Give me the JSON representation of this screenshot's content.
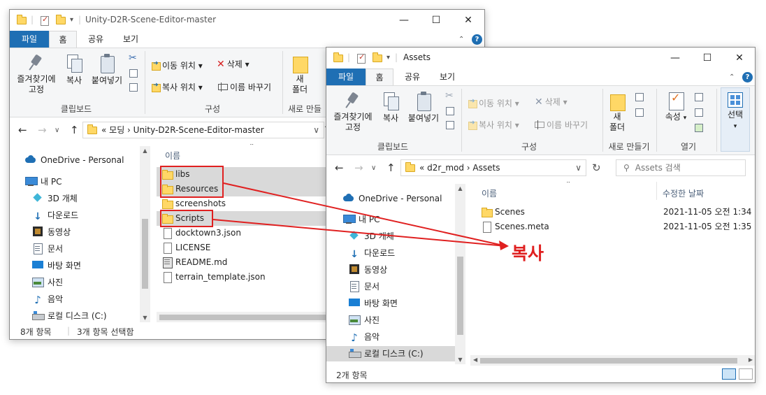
{
  "win1": {
    "title": "Unity-D2R-Scene-Editor-master",
    "tabs": [
      "파일",
      "홈",
      "공유",
      "보기"
    ],
    "ribbon": {
      "pin": "즐겨찾기에\n고정",
      "copy": "복사",
      "paste": "붙여넣기",
      "clipboard_label": "클립보드",
      "move_to": "이동 위치",
      "delete": "삭제",
      "copy_to": "복사 위치",
      "rename": "이름 바꾸기",
      "organize_label": "구성",
      "new_folder": "새\n폴더",
      "new_label": "새로 만들"
    },
    "breadcrumb": "«  모딩  ›  Unity-D2R-Scene-Editor-master",
    "nav": [
      "OneDrive - Personal",
      "내 PC",
      "3D 개체",
      "다운로드",
      "동영상",
      "문서",
      "바탕 화면",
      "사진",
      "음악",
      "로컬 디스크 (C:)"
    ],
    "col_name": "이름",
    "files": [
      {
        "name": "libs",
        "type": "folder",
        "selected": true
      },
      {
        "name": "Resources",
        "type": "folder",
        "selected": true
      },
      {
        "name": "screenshots",
        "type": "folder",
        "selected": false
      },
      {
        "name": "Scripts",
        "type": "folder",
        "selected": true
      },
      {
        "name": "docktown3.json",
        "type": "file",
        "selected": false
      },
      {
        "name": "LICENSE",
        "type": "file",
        "selected": false
      },
      {
        "name": "README.md",
        "type": "md",
        "selected": false
      },
      {
        "name": "terrain_template.json",
        "type": "file",
        "selected": false
      }
    ],
    "status_count": "8개 항목",
    "status_selected": "3개 항목 선택함"
  },
  "win2": {
    "title": "Assets",
    "tabs": [
      "파일",
      "홈",
      "공유",
      "보기"
    ],
    "ribbon": {
      "pin": "즐겨찾기에\n고정",
      "copy": "복사",
      "paste": "붙여넣기",
      "clipboard_label": "클립보드",
      "move_to": "이동 위치",
      "delete": "삭제",
      "copy_to": "복사 위치",
      "rename": "이름 바꾸기",
      "organize_label": "구성",
      "new_folder": "새\n폴더",
      "new_label": "새로 만들기",
      "properties": "속성",
      "open_label": "열기",
      "select": "선택"
    },
    "breadcrumb": "«  d2r_mod  ›  Assets",
    "search_placeholder": "Assets 검색",
    "nav": [
      "OneDrive - Personal",
      "내 PC",
      "3D 개체",
      "다운로드",
      "동영상",
      "문서",
      "바탕 화면",
      "사진",
      "음악",
      "로컬 디스크 (C:)"
    ],
    "col_name": "이름",
    "col_date": "수정한 날짜",
    "files": [
      {
        "name": "Scenes",
        "type": "folder",
        "date": "2021-11-05 오전 1:34"
      },
      {
        "name": "Scenes.meta",
        "type": "file",
        "date": "2021-11-05 오전 1:35"
      }
    ],
    "status_count": "2개 항목"
  },
  "annotation": {
    "text": "복사",
    "color": "#e02020"
  },
  "colors": {
    "accent": "#1f6fb4",
    "selection": "#d9d9d9",
    "highlight": "#e02020"
  }
}
